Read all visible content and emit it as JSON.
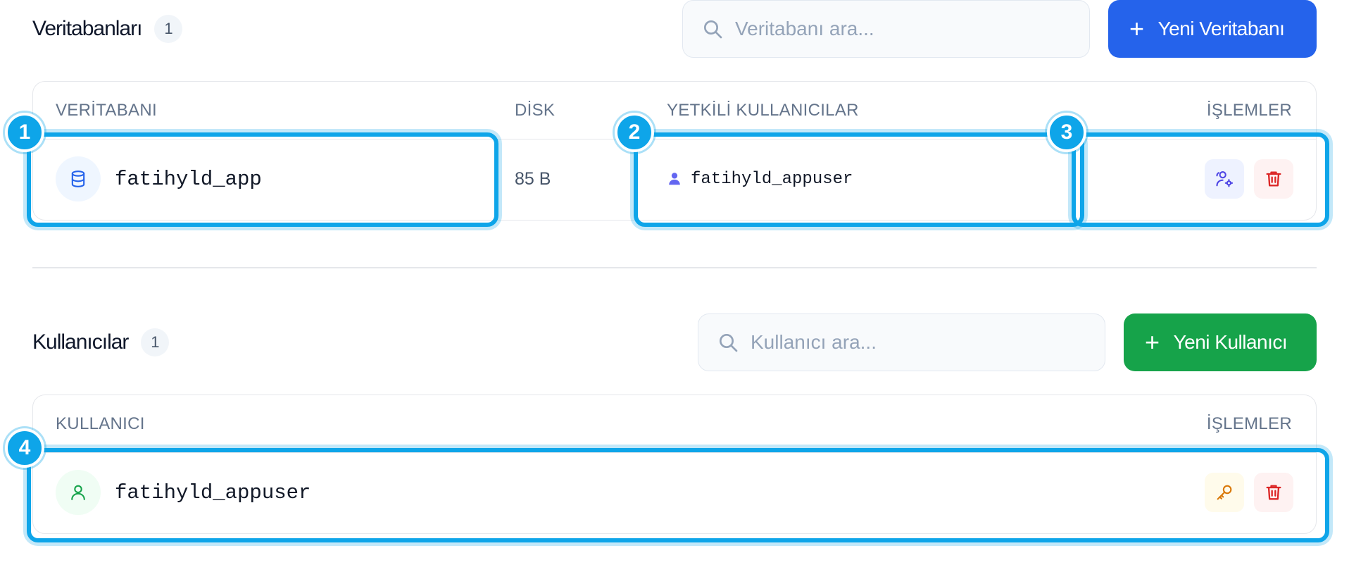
{
  "databases": {
    "title": "Veritabanları",
    "count": "1",
    "search_placeholder": "Veritabanı ara...",
    "new_button": "Yeni Veritabanı",
    "columns": {
      "database": "VERİTABANI",
      "disk": "DİSK",
      "authorized_users": "YETKİLİ KULLANICILAR",
      "actions": "İŞLEMLER"
    },
    "rows": [
      {
        "name": "fatihyld_app",
        "disk": "85 B",
        "users": [
          "fatihyld_appuser"
        ]
      }
    ]
  },
  "users": {
    "title": "Kullanıcılar",
    "count": "1",
    "search_placeholder": "Kullanıcı ara...",
    "new_button": "Yeni Kullanıcı",
    "columns": {
      "user": "KULLANICI",
      "actions": "İŞLEMLER"
    },
    "rows": [
      {
        "name": "fatihyld_appuser"
      }
    ]
  },
  "markers": [
    "1",
    "2",
    "3",
    "4"
  ],
  "colors": {
    "primary_blue": "#2563eb",
    "primary_green": "#16a34a",
    "highlight": "#0ea5e9",
    "danger": "#dc2626",
    "manage_users_icon": "#4f46e5",
    "key_icon": "#d97706"
  },
  "icons": {
    "search": "search-icon",
    "database": "database-icon",
    "user": "user-icon",
    "manage_users": "users-gear-icon",
    "delete": "trash-icon",
    "key": "key-icon",
    "plus": "plus-icon"
  }
}
